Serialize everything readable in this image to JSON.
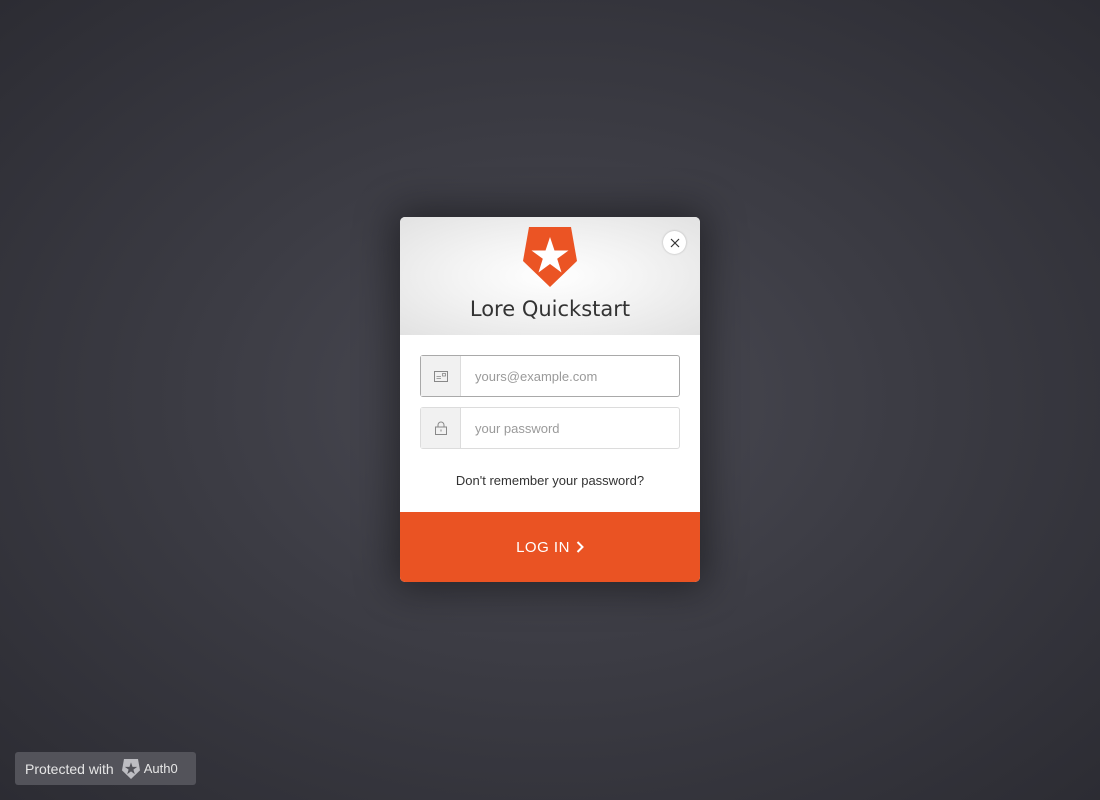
{
  "login": {
    "title": "Lore Quickstart",
    "email_placeholder": "yours@example.com",
    "password_placeholder": "your password",
    "forgot_link": "Don't remember your password?",
    "submit_label": "LOG IN"
  },
  "badge": {
    "prefix": "Protected with",
    "brand": "Auth0"
  },
  "colors": {
    "accent": "#ea5323",
    "background": "#3c3c44"
  },
  "icons": {
    "logo": "auth0-shield-star-icon",
    "close": "close-icon",
    "email": "envelope-icon",
    "password": "lock-icon",
    "submit": "chevron-right-icon"
  }
}
